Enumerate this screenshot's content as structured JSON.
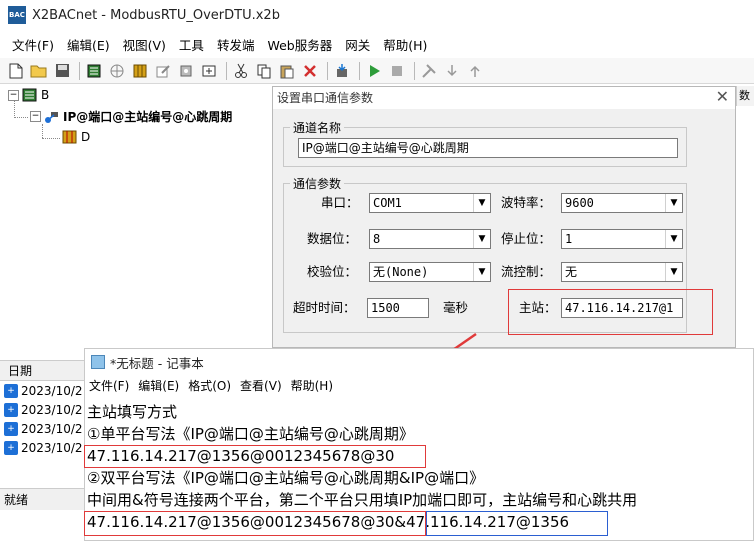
{
  "app": {
    "icon_text": "BAC",
    "title": "X2BACnet - ModbusRTU_OverDTU.x2b"
  },
  "menubar": [
    "文件(F)",
    "编辑(E)",
    "视图(V)",
    "工具",
    "转发端",
    "Web服务器",
    "网关",
    "帮助(H)"
  ],
  "toolbar": {
    "icons": [
      "new-file-icon",
      "open-folder-icon",
      "save-icon",
      "device-icon",
      "network-icon",
      "grid-icon",
      "edit-icon",
      "database-icon",
      "settings-icon",
      "cut-icon",
      "copy-icon",
      "paste-icon",
      "delete-icon",
      "import-icon",
      "run-icon",
      "stop-icon",
      "tools-icon",
      "load-icon",
      "export-icon"
    ]
  },
  "tree": {
    "root_label": "B",
    "channel_label": "IP@端口@主站编号@心跳周期",
    "device_label": "D"
  },
  "right_column_header": "数",
  "log": {
    "header": "日期",
    "rows": [
      "2023/10/2",
      "2023/10/2",
      "2023/10/2",
      "2023/10/2"
    ]
  },
  "statusbar": "就绪",
  "dialog": {
    "title": "设置串口通信参数",
    "close_symbol": "✕",
    "channel_group_title": "通道名称",
    "channel_name_value": "IP@端口@主站编号@心跳周期",
    "comm_group_title": "通信参数",
    "port_label": "串口：",
    "port_value": "COM1",
    "baud_label": "波特率：",
    "baud_value": "9600",
    "databits_label": "数据位：",
    "databits_value": "8",
    "stopbits_label": "停止位：",
    "stopbits_value": "1",
    "parity_label": "校验位：",
    "parity_value": "无(None)",
    "flow_label": "流控制：",
    "flow_value": "无",
    "timeout_label": "超时时间：",
    "timeout_value": "1500",
    "timeout_unit": "毫秒",
    "master_label": "主站：",
    "master_value": "47.116.14.217@1"
  },
  "notepad": {
    "title": "*无标题 - 记事本",
    "menu": [
      "文件(F)",
      "编辑(E)",
      "格式(O)",
      "查看(V)",
      "帮助(H)"
    ],
    "lines": [
      "主站填写方式",
      "①单平台写法《IP@端口@主站编号@心跳周期》",
      "47.116.14.217@1356@0012345678@30",
      "②双平台写法《IP@端口@主站编号@心跳周期&IP@端口》",
      "中间用&符号连接两个平台，第二个平台只用填IP加端口即可，主站编号和心跳共用",
      "47.116.14.217@1356@0012345678@30&47.116.14.217@1356"
    ]
  },
  "colors": {
    "highlight_red": "#e03a3a",
    "highlight_blue": "#2b5fd1"
  }
}
